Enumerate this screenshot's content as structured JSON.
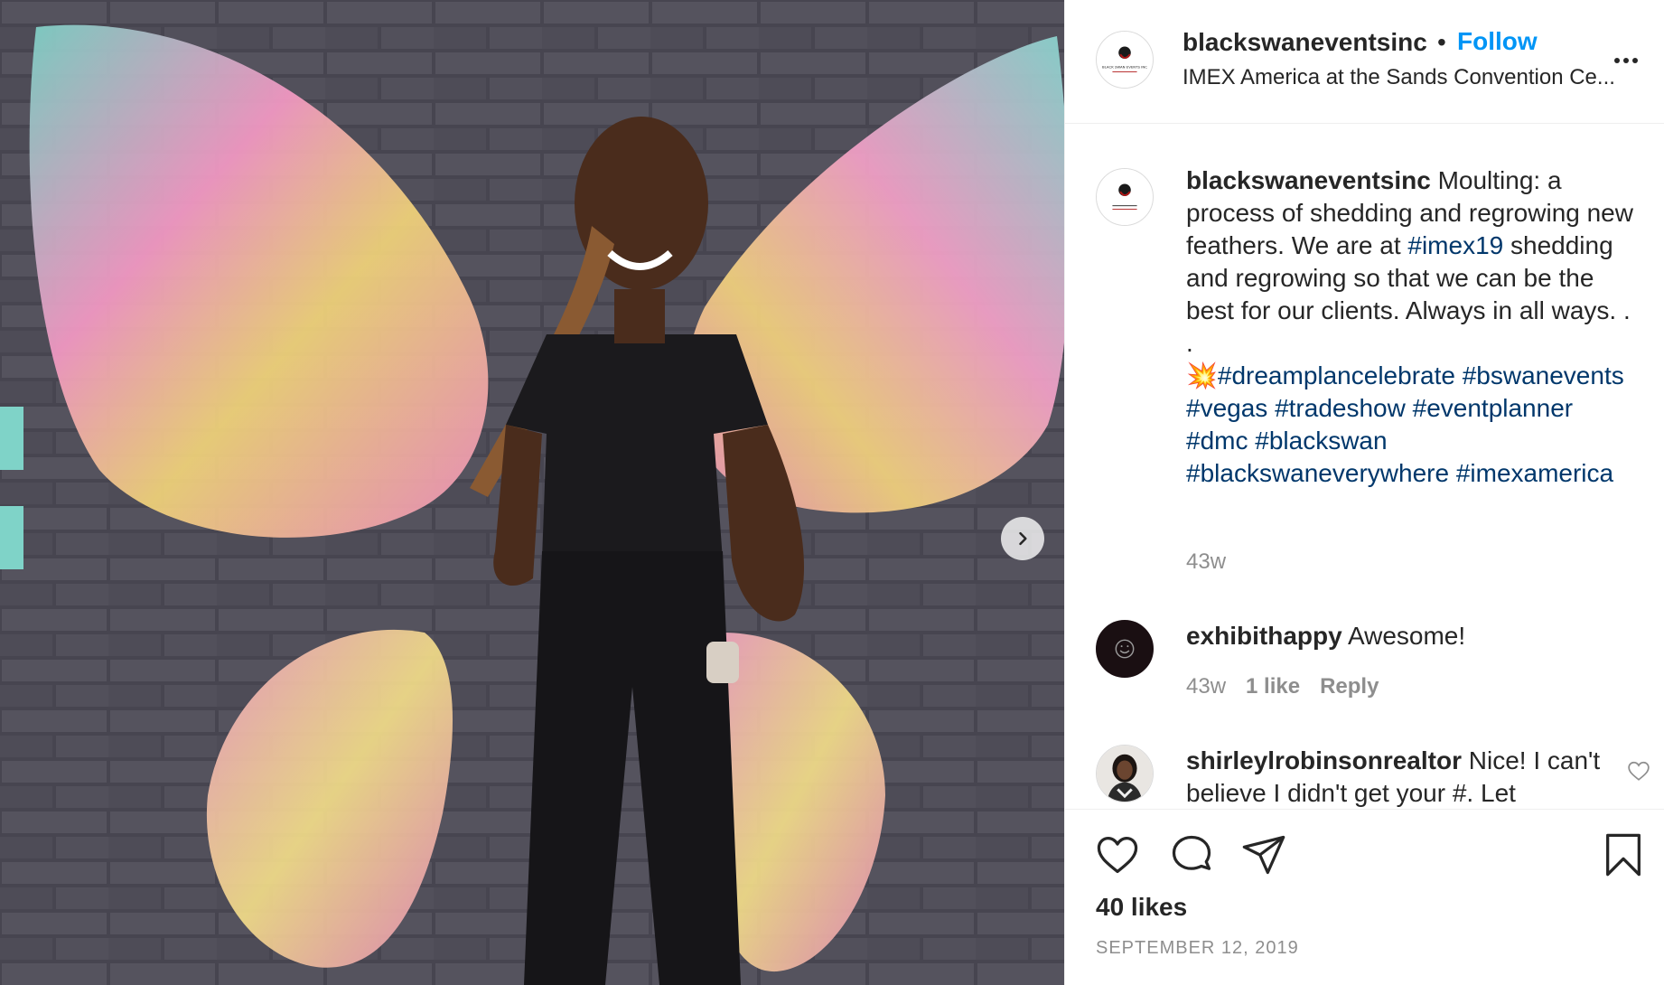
{
  "post": {
    "username": "blackswaneventsinc",
    "separator": "•",
    "follow_label": "Follow",
    "location": "IMEX America at the Sands Convention Ce...",
    "more_icon": "more-options-icon",
    "avatar_text": "BLACK SWAN EVENTS INC",
    "caption": {
      "username": "blackswaneventsinc",
      "text_1": " Moulting: a process of shedding and regrowing new feathers. We are at ",
      "tag_1": "#imex19",
      "text_2": " shedding and regrowing so that we can be the best for our clients. Always in all ways. .",
      "dot_line": ".",
      "emoji": "💥",
      "tags": [
        "#dreamplancelebrate",
        "#bswanevents",
        "#vegas",
        "#tradeshow",
        "#eventplanner",
        "#dmc",
        "#blackswan",
        "#blackswaneverywhere",
        "#imexamerica"
      ],
      "time": "43w"
    },
    "comments": [
      {
        "username": "exhibithappy",
        "text": " Awesome!",
        "time": "43w",
        "likes": "1 like",
        "reply": "Reply"
      },
      {
        "username": "shirleylrobinsonrealtor",
        "text": " Nice! I can't believe I didn't get your #. Let"
      }
    ],
    "likes": "40 likes",
    "date": "SEPTEMBER 12, 2019"
  },
  "colors": {
    "link": "#0095f6",
    "hashtag": "#00376b",
    "muted": "#8e8e8e",
    "text": "#262626"
  }
}
